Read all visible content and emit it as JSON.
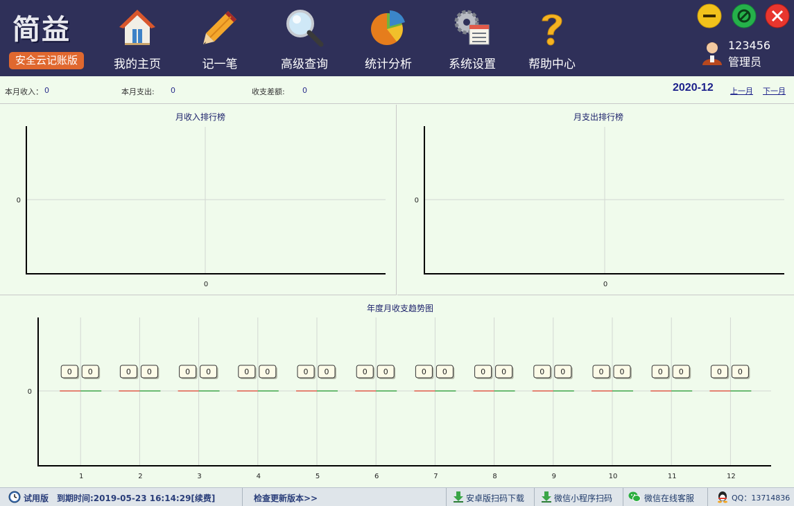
{
  "app": {
    "logo_title": "简益",
    "logo_subtitle": "安全云记账版"
  },
  "nav": [
    {
      "label": "我的主页",
      "icon": "home-icon"
    },
    {
      "label": "记一笔",
      "icon": "pencil-icon"
    },
    {
      "label": "高级查询",
      "icon": "magnifier-icon"
    },
    {
      "label": "统计分析",
      "icon": "pie-chart-icon"
    },
    {
      "label": "系统设置",
      "icon": "settings-icon"
    },
    {
      "label": "帮助中心",
      "icon": "question-icon"
    }
  ],
  "window_controls": [
    {
      "name": "minimize-button",
      "icon": "minus-icon",
      "color": "#f2c21b"
    },
    {
      "name": "restore-button",
      "icon": "restore-icon",
      "color": "#25b14a"
    },
    {
      "name": "close-button",
      "icon": "close-icon",
      "color": "#e8362e"
    }
  ],
  "user": {
    "id": "123456",
    "role": "管理员",
    "icon": "user-avatar-icon"
  },
  "summary": {
    "income_label": "本月收入：",
    "income_value": "0",
    "expense_label": "本月支出:",
    "expense_value": "0",
    "diff_label": "收支差额:",
    "diff_value": "0",
    "period": "2020-12",
    "prev_month": "上一月",
    "next_month": "下一月"
  },
  "chart_data": [
    {
      "type": "bar",
      "title": "月收入排行榜",
      "categories": [],
      "values": [],
      "y_ticks": [
        "0"
      ],
      "x_ticks": [
        "0"
      ],
      "grid": true
    },
    {
      "type": "bar",
      "title": "月支出排行榜",
      "categories": [],
      "values": [],
      "y_ticks": [
        "0"
      ],
      "x_ticks": [
        "0"
      ],
      "grid": true
    },
    {
      "type": "line",
      "title": "年度月收支趋势图",
      "x": [
        1,
        2,
        3,
        4,
        5,
        6,
        7,
        8,
        9,
        10,
        11,
        12
      ],
      "y_ticks": [
        "0"
      ],
      "grid": true,
      "series": [
        {
          "values": [
            0,
            0,
            0,
            0,
            0,
            0,
            0,
            0,
            0,
            0,
            0,
            0
          ],
          "color": "#e05a4a"
        },
        {
          "values": [
            0,
            0,
            0,
            0,
            0,
            0,
            0,
            0,
            0,
            0,
            0,
            0
          ],
          "color": "#3fa64a"
        }
      ],
      "data_labels": true
    }
  ],
  "statusbar": {
    "trial_label": "试用版",
    "expiry": "到期时间:2019-05-23 16:14:29[续费]",
    "check_update": "检查更新版本>>",
    "android_download": "安卓版扫码下载",
    "wechat_mini": "微信小程序扫码",
    "wechat_service": "微信在线客服",
    "qq": "QQ：13714836"
  }
}
